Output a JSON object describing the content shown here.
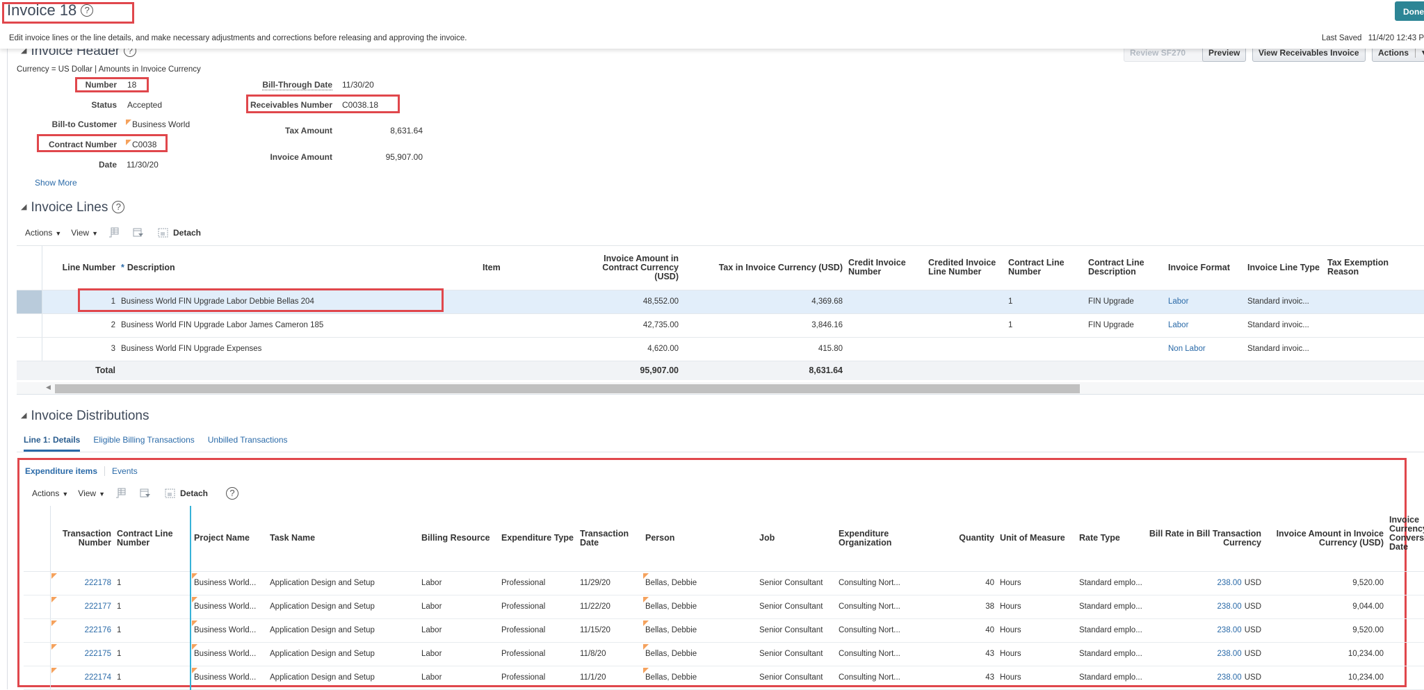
{
  "page": {
    "title": "Invoice 18",
    "instructions": "Edit invoice lines or the line details, and make necessary adjustments and corrections before releasing and approving the invoice.",
    "last_saved_label": "Last Saved",
    "last_saved_value": "11/4/20 12:43 P",
    "done_label": "Done"
  },
  "header_section": {
    "title": "Invoice Header",
    "currency_note": "Currency = US Dollar | Amounts in Invoice Currency",
    "buttons": {
      "review_sf270": "Review SF270",
      "preview": "Preview",
      "view_receivables_invoice": "View Receivables Invoice",
      "actions": "Actions"
    },
    "fields": {
      "number": {
        "label": "Number",
        "value": "18"
      },
      "status": {
        "label": "Status",
        "value": "Accepted"
      },
      "bill_to_customer": {
        "label": "Bill-to Customer",
        "value": "Business World"
      },
      "contract_number": {
        "label": "Contract Number",
        "value": "C0038"
      },
      "date": {
        "label": "Date",
        "value": "11/30/20"
      },
      "bill_through_date": {
        "label": "Bill-Through Date",
        "value": "11/30/20"
      },
      "receivables_number": {
        "label": "Receivables Number",
        "value": "C0038.18"
      },
      "tax_amount": {
        "label": "Tax Amount",
        "value": "8,631.64"
      },
      "invoice_amount": {
        "label": "Invoice Amount",
        "value": "95,907.00"
      }
    },
    "show_more": "Show More"
  },
  "lines_section": {
    "title": "Invoice Lines",
    "toolbar": {
      "actions": "Actions",
      "view": "View",
      "detach": "Detach"
    },
    "columns": {
      "line_number": "Line Number",
      "description_required": "*",
      "description": "Description",
      "item": "Item",
      "invoice_amount": "Invoice Amount in Contract Currency (USD)",
      "tax": "Tax in Invoice Currency (USD)",
      "credit_invoice_number": "Credit Invoice Number",
      "credited_invoice_line_number": "Credited Invoice Line Number",
      "contract_line_number": "Contract Line Number",
      "contract_line_description": "Contract Line Description",
      "invoice_format": "Invoice Format",
      "invoice_line_type": "Invoice Line Type",
      "tax_exemption_reason": "Tax Exemption Reason"
    },
    "rows": [
      {
        "line": "1",
        "description": "Business World FIN Upgrade Labor Debbie Bellas 204",
        "item": "",
        "amount": "48,552.00",
        "tax": "4,369.68",
        "credit_inv": "",
        "credited_line": "",
        "contract_line": "1",
        "contract_line_desc": "FIN Upgrade",
        "format": "Labor",
        "line_type": "Standard invoic...",
        "tax_exempt": ""
      },
      {
        "line": "2",
        "description": "Business World FIN Upgrade Labor James Cameron 185",
        "item": "",
        "amount": "42,735.00",
        "tax": "3,846.16",
        "credit_inv": "",
        "credited_line": "",
        "contract_line": "1",
        "contract_line_desc": "FIN Upgrade",
        "format": "Labor",
        "line_type": "Standard invoic...",
        "tax_exempt": ""
      },
      {
        "line": "3",
        "description": "Business World FIN Upgrade Expenses",
        "item": "",
        "amount": "4,620.00",
        "tax": "415.80",
        "credit_inv": "",
        "credited_line": "",
        "contract_line": "",
        "contract_line_desc": "",
        "format": "Non Labor",
        "line_type": "Standard invoic...",
        "tax_exempt": ""
      }
    ],
    "total": {
      "label": "Total",
      "amount": "95,907.00",
      "tax": "8,631.64"
    }
  },
  "distributions_section": {
    "title": "Invoice Distributions",
    "tabs": [
      "Line 1: Details",
      "Eligible Billing Transactions",
      "Unbilled Transactions"
    ],
    "subtabs": [
      "Expenditure items",
      "Events"
    ],
    "toolbar": {
      "actions": "Actions",
      "view": "View",
      "detach": "Detach"
    },
    "columns": {
      "transaction_number": "Transaction Number",
      "contract_line_number": "Contract Line Number",
      "project_name": "Project Name",
      "task_name": "Task Name",
      "billing_resource": "Billing Resource",
      "expenditure_type": "Expenditure Type",
      "transaction_date": "Transaction Date",
      "person": "Person",
      "job": "Job",
      "expenditure_org": "Expenditure Organization",
      "quantity": "Quantity",
      "uom": "Unit of Measure",
      "rate_type": "Rate Type",
      "bill_rate": "Bill Rate in Bill Transaction Currency",
      "invoice_amount": "Invoice Amount in Invoice Currency (USD)",
      "conversion_date": "Invoice Currency Conversion Date"
    },
    "rows": [
      {
        "txn": "222178",
        "cline": "1",
        "project": "Business World...",
        "task": "Application Design and Setup",
        "resource": "Labor",
        "exp_type": "Professional",
        "date": "11/29/20",
        "person": "Bellas, Debbie",
        "job": "Senior Consultant",
        "org": "Consulting Nort...",
        "qty": "40",
        "uom": "Hours",
        "rate_type": "Standard emplo...",
        "rate": "238.00",
        "rate_ccy": "USD",
        "amount": "9,520.00"
      },
      {
        "txn": "222177",
        "cline": "1",
        "project": "Business World...",
        "task": "Application Design and Setup",
        "resource": "Labor",
        "exp_type": "Professional",
        "date": "11/22/20",
        "person": "Bellas, Debbie",
        "job": "Senior Consultant",
        "org": "Consulting Nort...",
        "qty": "38",
        "uom": "Hours",
        "rate_type": "Standard emplo...",
        "rate": "238.00",
        "rate_ccy": "USD",
        "amount": "9,044.00"
      },
      {
        "txn": "222176",
        "cline": "1",
        "project": "Business World...",
        "task": "Application Design and Setup",
        "resource": "Labor",
        "exp_type": "Professional",
        "date": "11/15/20",
        "person": "Bellas, Debbie",
        "job": "Senior Consultant",
        "org": "Consulting Nort...",
        "qty": "40",
        "uom": "Hours",
        "rate_type": "Standard emplo...",
        "rate": "238.00",
        "rate_ccy": "USD",
        "amount": "9,520.00"
      },
      {
        "txn": "222175",
        "cline": "1",
        "project": "Business World...",
        "task": "Application Design and Setup",
        "resource": "Labor",
        "exp_type": "Professional",
        "date": "11/8/20",
        "person": "Bellas, Debbie",
        "job": "Senior Consultant",
        "org": "Consulting Nort...",
        "qty": "43",
        "uom": "Hours",
        "rate_type": "Standard emplo...",
        "rate": "238.00",
        "rate_ccy": "USD",
        "amount": "10,234.00"
      },
      {
        "txn": "222174",
        "cline": "1",
        "project": "Business World...",
        "task": "Application Design and Setup",
        "resource": "Labor",
        "exp_type": "Professional",
        "date": "11/1/20",
        "person": "Bellas, Debbie",
        "job": "Senior Consultant",
        "org": "Consulting Nort...",
        "qty": "43",
        "uom": "Hours",
        "rate_type": "Standard emplo...",
        "rate": "238.00",
        "rate_ccy": "USD",
        "amount": "10,234.00"
      }
    ]
  },
  "colors": {
    "accent_button": "#2d8595",
    "link": "#2a6aa8",
    "highlight_box": "#e0474c",
    "selected_row": "#e2eefa",
    "flag": "#f5a25d"
  }
}
